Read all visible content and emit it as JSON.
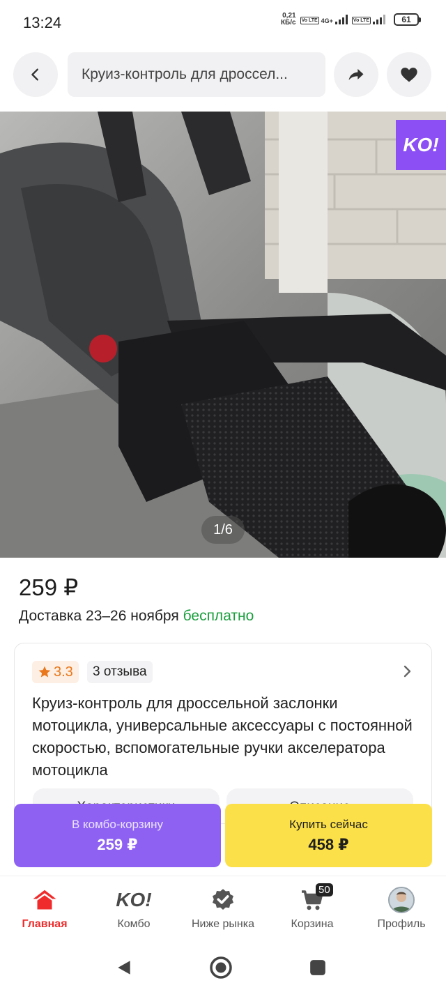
{
  "status_bar": {
    "time": "13:24",
    "net_speed_value": "0,21",
    "net_speed_unit": "КБ/с",
    "network_type": "4G+",
    "sim_tag": "Vo LTE",
    "battery": "61"
  },
  "header": {
    "search_text": "Круиз-контроль для дроссел..."
  },
  "gallery": {
    "badge": "KO!",
    "counter": "1/6"
  },
  "product": {
    "price": "259 ₽",
    "delivery_prefix": "Доставка 23–26 ноября",
    "delivery_free": "бесплатно",
    "rating": "3.3",
    "reviews": "3 отзыва",
    "title": "Круиз-контроль для дроссельной заслонки мотоцикла, универсальные аксессуары с постоянной скоростью, вспомогательные ручки акселератора мотоцикла",
    "tab_characteristics": "Характеристики",
    "tab_description": "Описание"
  },
  "actions": {
    "combo_label": "В комбо-корзину",
    "combo_price": "259 ₽",
    "buy_label": "Купить сейчас",
    "buy_price": "458 ₽"
  },
  "bottom_nav": {
    "items": [
      {
        "label": "Главная",
        "icon": "home-icon",
        "active": true
      },
      {
        "label": "Комбо",
        "icon": "ko-logo-icon"
      },
      {
        "label": "Ниже рынка",
        "icon": "verified-check-icon"
      },
      {
        "label": "Корзина",
        "icon": "cart-icon",
        "badge": "50"
      },
      {
        "label": "Профиль",
        "icon": "avatar"
      }
    ]
  },
  "colors": {
    "accent_red": "#ef2b2b",
    "combo_purple": "#8e61f3",
    "buy_yellow": "#fbe049",
    "free_green": "#1b9e3e",
    "rating_orange": "#e9771b"
  }
}
